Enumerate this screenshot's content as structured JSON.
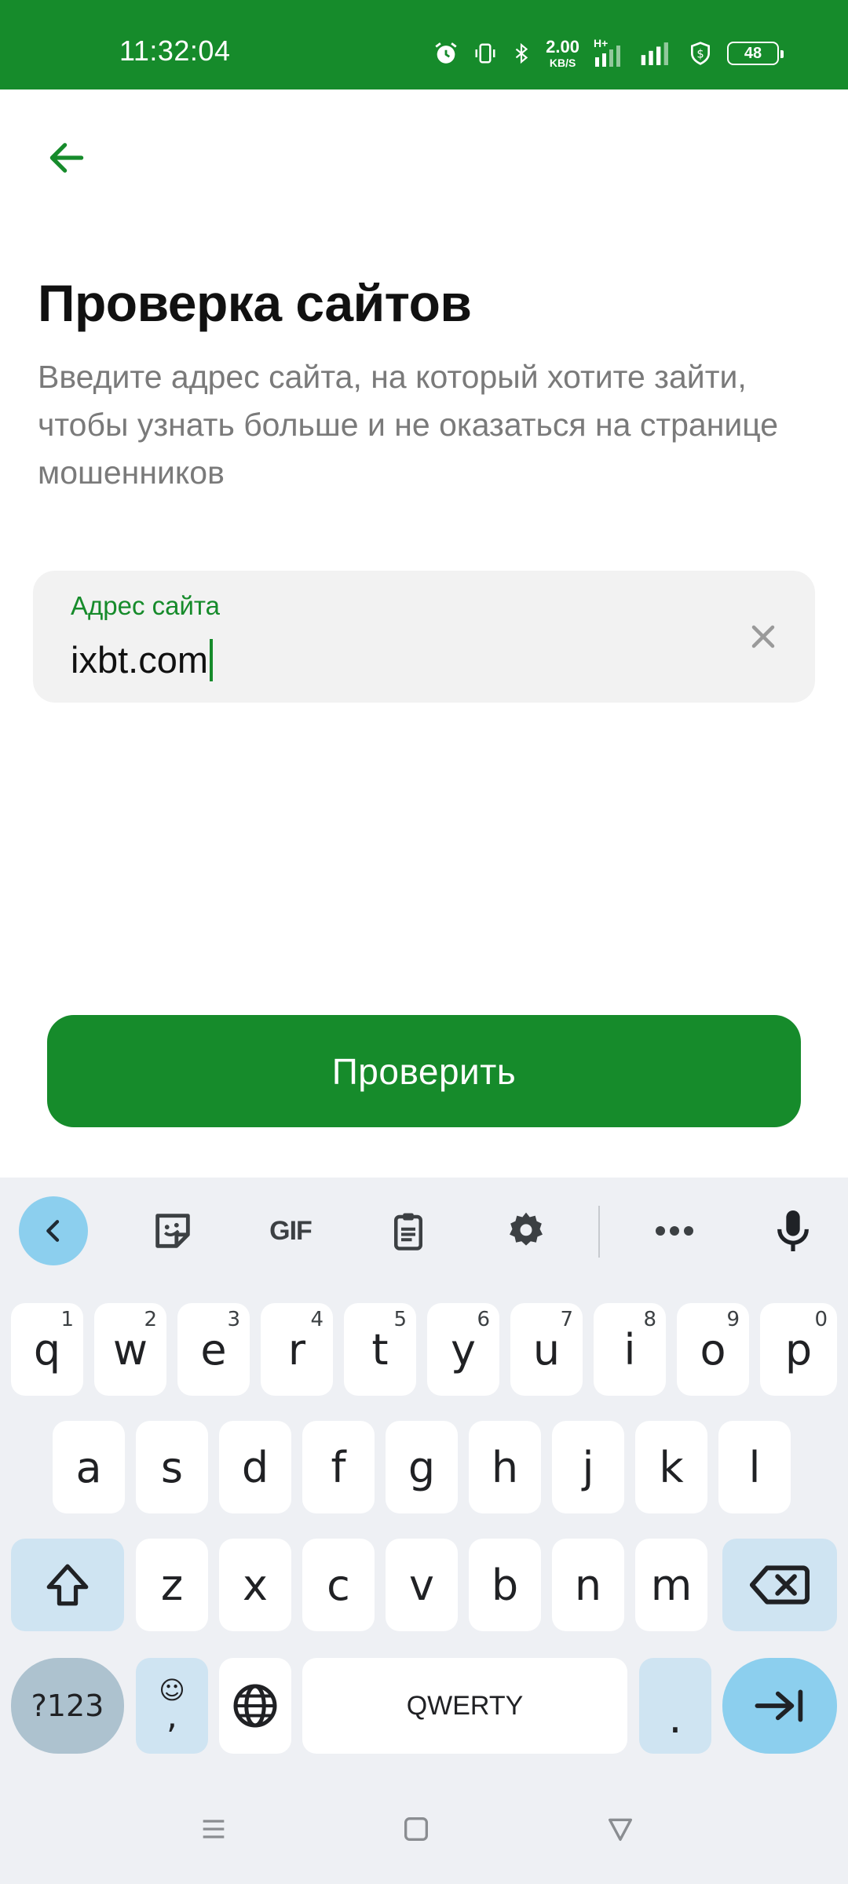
{
  "status_bar": {
    "time": "11:32:04",
    "net_speed_value": "2.00",
    "net_speed_unit": "KB/S",
    "network_type": "H+",
    "battery": "48"
  },
  "header": {
    "back_icon": "arrow-left-icon",
    "title": "Проверка сайтов",
    "subtitle": "Введите адрес сайта, на который хотите зайти, чтобы узнать больше и не оказаться на странице мошенников"
  },
  "address_input": {
    "label": "Адрес сайта",
    "value": "ixbt.com",
    "clear_icon": "close-icon"
  },
  "actions": {
    "check_label": "Проверить"
  },
  "keyboard": {
    "toolbar": [
      "chevron-left-icon",
      "sticker-icon",
      "GIF",
      "clipboard-icon",
      "gear-icon",
      "more-icon",
      "microphone-icon"
    ],
    "row1": [
      {
        "k": "q",
        "h": "1"
      },
      {
        "k": "w",
        "h": "2"
      },
      {
        "k": "e",
        "h": "3"
      },
      {
        "k": "r",
        "h": "4"
      },
      {
        "k": "t",
        "h": "5"
      },
      {
        "k": "y",
        "h": "6"
      },
      {
        "k": "u",
        "h": "7"
      },
      {
        "k": "i",
        "h": "8"
      },
      {
        "k": "o",
        "h": "9"
      },
      {
        "k": "p",
        "h": "0"
      }
    ],
    "row2": [
      "a",
      "s",
      "d",
      "f",
      "g",
      "h",
      "j",
      "k",
      "l"
    ],
    "row3": [
      "z",
      "x",
      "c",
      "v",
      "b",
      "n",
      "m"
    ],
    "symbols_label": "?123",
    "emoji_label": "☺",
    "comma_label": ",",
    "space_label": "QWERTY",
    "period_label": "."
  },
  "colors": {
    "brand_green": "#168b2b",
    "keyboard_bg": "#eef0f4",
    "key_accent": "#8ccfee"
  }
}
